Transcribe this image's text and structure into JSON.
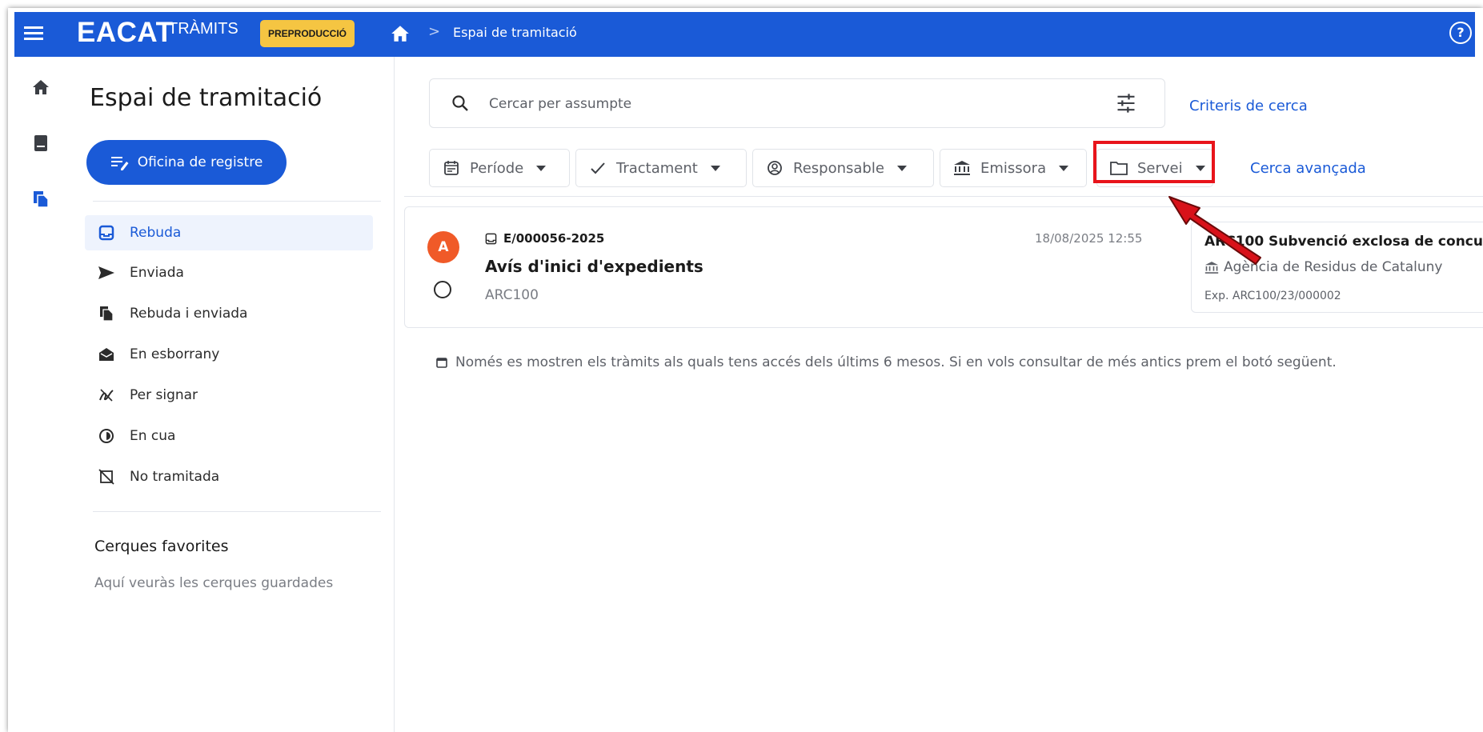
{
  "header": {
    "logo": "EACAT",
    "logo_sub": "TRÀMITS",
    "env_badge": "PREPRODUCCIÓ",
    "breadcrumb": "Espai de tramitació",
    "help_label": "?"
  },
  "sidebar": {
    "title": "Espai de tramitació",
    "office_button": "Oficina de registre",
    "items": [
      {
        "label": "Rebuda",
        "icon": "inbox-icon"
      },
      {
        "label": "Enviada",
        "icon": "send-icon"
      },
      {
        "label": "Rebuda i enviada",
        "icon": "documents-icon"
      },
      {
        "label": "En esborrany",
        "icon": "drafts-icon"
      },
      {
        "label": "Per signar",
        "icon": "signature-icon"
      },
      {
        "label": "En cua",
        "icon": "queue-icon"
      },
      {
        "label": "No tramitada",
        "icon": "not-processed-icon"
      }
    ],
    "favorites_title": "Cerques favorites",
    "favorites_empty": "Aquí veuràs les cerques guardades"
  },
  "search": {
    "placeholder": "Cercar per assumpte",
    "criteria_link": "Criteris de cerca"
  },
  "filters": [
    {
      "label": "Període",
      "icon": "calendar-icon"
    },
    {
      "label": "Tractament",
      "icon": "check-icon"
    },
    {
      "label": "Responsable",
      "icon": "user-circle-icon"
    },
    {
      "label": "Emissora",
      "icon": "institution-icon"
    },
    {
      "label": "Servei",
      "icon": "folder-icon"
    }
  ],
  "advanced_search": "Cerca avançada",
  "result": {
    "avatar": "A",
    "reference": "E/000056-2025",
    "subject": "Avís d'inici d'expedients",
    "code": "ARC100",
    "date": "18/08/2025 12:55",
    "expedient": {
      "code": "ARC100",
      "title": "Subvenció exclosa de concu",
      "organization": "Agència de Residus de Cataluny",
      "number": "Exp. ARC100/23/000002"
    }
  },
  "notice": "Només es mostren els tràmits als quals tens accés dels últims 6 mesos. Si en vols consultar de més antics prem el botó següent.",
  "colors": {
    "primary": "#1a5ad7",
    "badge": "#f5c542",
    "avatar": "#f05a28",
    "highlight": "#e8141b"
  }
}
